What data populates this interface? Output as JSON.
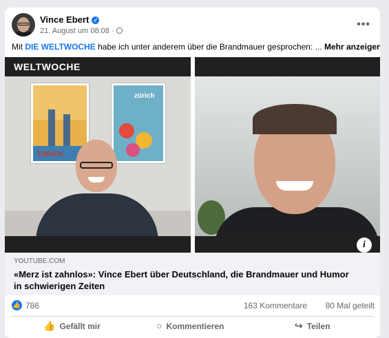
{
  "post": {
    "author": "Vince Ebert",
    "verified_badge": "✓",
    "timestamp": "21. August um 08:08 ·",
    "menu_icon": "•••",
    "text_prefix": "Mit ",
    "text_tag": "DIE WELTWOCHE",
    "text_body": " habe ich unter anderem über die Brandmauer gesprochen: ... ",
    "more_label": "Mehr anzeigen"
  },
  "media": {
    "overlay_logo": "WELTWOCHE",
    "poster1_text": "ZÜRICH",
    "poster2_text": "zürich",
    "info_button": "i"
  },
  "link": {
    "domain": "YOUTUBE.COM",
    "title": "«Merz ist zahnlos»: Vince Ebert über Deutschland, die Brandmauer und Humor in schwierigen Zeiten"
  },
  "stats": {
    "likes": "786",
    "comments": "163 Kommentare",
    "shares": "80 Mal geteilt"
  },
  "actions": {
    "like": "Gefällt mir",
    "comment": "Kommentieren",
    "share": "Teilen"
  },
  "colors": {
    "accent": "#1877f2",
    "background": "#e9ebee"
  }
}
